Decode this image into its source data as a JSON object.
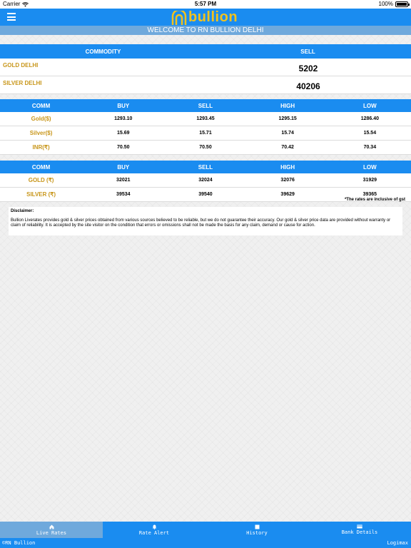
{
  "status": {
    "carrier": "Carrier",
    "time": "5:57 PM",
    "battery": "100%"
  },
  "header": {
    "logo_text": "bullion",
    "welcome": "WELCOME TO RN BULLION DELHI"
  },
  "commodity_table": {
    "headers": [
      "COMMODITY",
      "SELL"
    ],
    "rows": [
      {
        "name": "GOLD DELHI",
        "sell": "5202"
      },
      {
        "name": "SILVER DELHI",
        "sell": "40206"
      }
    ]
  },
  "spot_table": {
    "headers": [
      "COMM",
      "BUY",
      "SELL",
      "HIGH",
      "LOW"
    ],
    "rows": [
      {
        "name": "Gold($)",
        "buy": "1293.10",
        "sell": "1293.45",
        "high": "1295.15",
        "low": "1286.40"
      },
      {
        "name": "Silver($)",
        "buy": "15.69",
        "sell": "15.71",
        "high": "15.74",
        "low": "15.54"
      },
      {
        "name": "INR(₹)",
        "buy": "70.50",
        "sell": "70.50",
        "high": "70.42",
        "low": "70.34"
      }
    ]
  },
  "rupee_table": {
    "headers": [
      "COMM",
      "BUY",
      "SELL",
      "HIGH",
      "LOW"
    ],
    "rows": [
      {
        "name": "GOLD (₹)",
        "buy": "32021",
        "sell": "32024",
        "high": "32076",
        "low": "31929"
      },
      {
        "name": "SILVER (₹)",
        "buy": "39534",
        "sell": "39540",
        "high": "39629",
        "low": "39365"
      }
    ]
  },
  "gst_note": "*The rates are inclusive of gst",
  "disclaimer": {
    "title": "Disclaimer:",
    "body": "Bullion Liverates provides gold & silver prices obtained from various sources believed to be reliable, but we do not guarantee their accuracy. Our gold & silver price data are provided without warranty or claim of reliability. It is accepted by the site visitor on the condition that errors or omissions shall not be made the basis for any claim, demand or cause for action."
  },
  "tabs": [
    {
      "label": "Live Rates",
      "icon": "home-icon"
    },
    {
      "label": "Rate Alert",
      "icon": "bell-icon"
    },
    {
      "label": "History",
      "icon": "calendar-icon"
    },
    {
      "label": "Bank Details",
      "icon": "card-icon"
    }
  ],
  "footer": {
    "left": "©RN Bullion",
    "right": "Logimax"
  },
  "colors": {
    "primary": "#1a8cf0",
    "light": "#6fa9dc",
    "gold": "#c8961a",
    "logo": "#f2c21d"
  }
}
